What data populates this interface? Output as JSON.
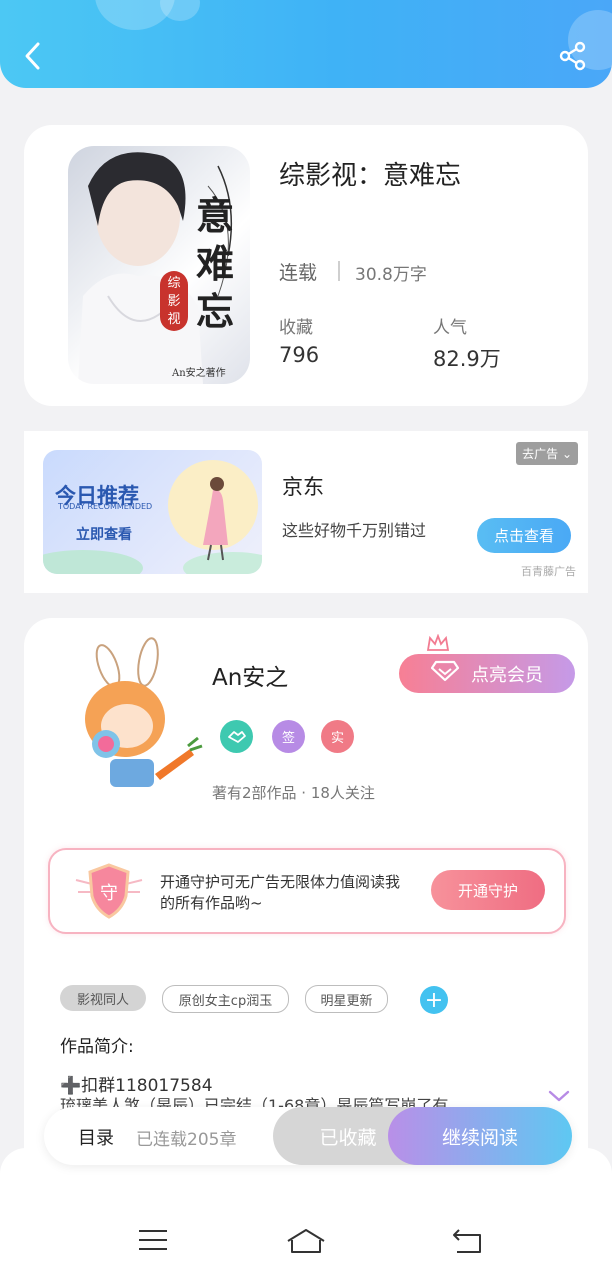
{
  "header": {
    "back_icon": "back-arrow-icon",
    "share_icon": "share-icon"
  },
  "book": {
    "title": "综影视：意难忘",
    "cover_text": "意难忘",
    "cover_series": "综影视",
    "cover_author": "An安之著作",
    "status": "连载",
    "word_count": "30.8万字",
    "favorites_label": "收藏",
    "favorites_value": "796",
    "popularity_label": "人气",
    "popularity_value": "82.9万"
  },
  "ad": {
    "tag": "去广告",
    "image_title": "今日推荐",
    "image_subtitle": "TODAY RECOMMENDED",
    "image_cta": "立即查看",
    "brand": "京东",
    "description": "这些好物千万别错过",
    "button": "点击查看",
    "source": "百青藤广告"
  },
  "author": {
    "name": "An安之",
    "vip_button": "点亮会员",
    "badges": [
      {
        "name": "handshake-badge-icon",
        "color": "#3ec9b0"
      },
      {
        "name": "sign-badge",
        "label": "签",
        "color": "#b78be5"
      },
      {
        "name": "verified-badge",
        "label": "实",
        "color": "#f07a86"
      }
    ],
    "meta": "著有2部作品 · 18人关注"
  },
  "guard": {
    "shield_text": "守",
    "text": "开通守护可无广告无限体力值阅读我的所有作品哟~",
    "button": "开通守护"
  },
  "tags": [
    "影视同人",
    "原创女主cp润玉",
    "明星更新"
  ],
  "intro": {
    "label": "作品简介:",
    "line1": "➕扣群118017584",
    "line2": "琉璃美人煞（旻辰）已完结（1-68章）旻辰篇写崩了有…"
  },
  "bottom": {
    "catalog_label": "目录",
    "chapter_count": "已连载205章",
    "collected_button": "已收藏",
    "read_button": "继续阅读"
  },
  "colors": {
    "accent": "#4aa9f5",
    "vip_pink": "#f77f94",
    "vip_purple": "#c59ae8"
  }
}
